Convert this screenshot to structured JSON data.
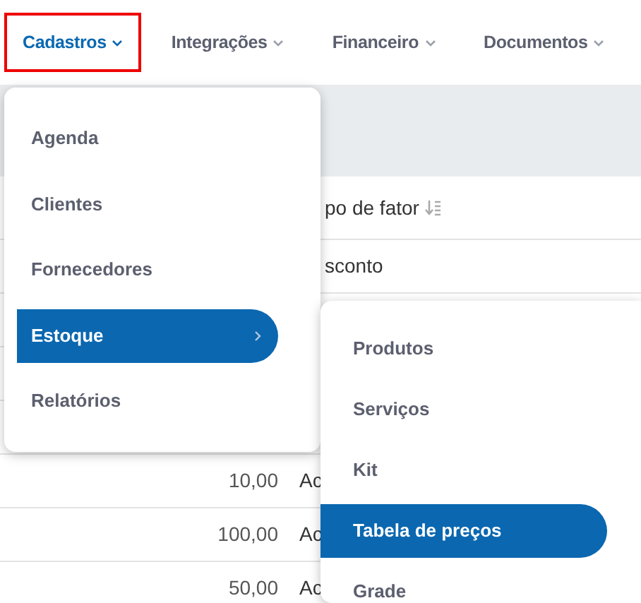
{
  "nav": [
    {
      "label": "Cadastros",
      "selected": true,
      "highlighted": true,
      "chevron": true
    },
    {
      "label": "Integrações",
      "selected": false,
      "highlighted": false,
      "chevron": true
    },
    {
      "label": "Financeiro",
      "selected": false,
      "highlighted": false,
      "chevron": true
    },
    {
      "label": "Documentos",
      "selected": false,
      "highlighted": false,
      "chevron": true
    }
  ],
  "table": {
    "header": {
      "column_2": "po de fator"
    },
    "rows": [
      {
        "column_1": "",
        "column_2": "sconto"
      },
      {
        "column_1": "10,00",
        "column_2": "Ac"
      },
      {
        "column_1": "100,00",
        "column_2": "Ac"
      },
      {
        "column_1": "50,00",
        "column_2": "Ac"
      }
    ]
  },
  "menu": {
    "items": [
      {
        "label": "Agenda",
        "selected": false,
        "submenu": false
      },
      {
        "label": "Clientes",
        "selected": false,
        "submenu": false
      },
      {
        "label": "Fornecedores",
        "selected": false,
        "submenu": false
      },
      {
        "label": "Estoque",
        "selected": true,
        "submenu": true
      },
      {
        "label": "Relatórios",
        "selected": false,
        "submenu": false
      }
    ]
  },
  "submenu": {
    "items": [
      {
        "label": "Produtos",
        "selected": false
      },
      {
        "label": "Serviços",
        "selected": false
      },
      {
        "label": "Kit",
        "selected": false
      },
      {
        "label": "Tabela de preços",
        "selected": true
      },
      {
        "label": "Grade",
        "selected": false
      }
    ]
  }
}
